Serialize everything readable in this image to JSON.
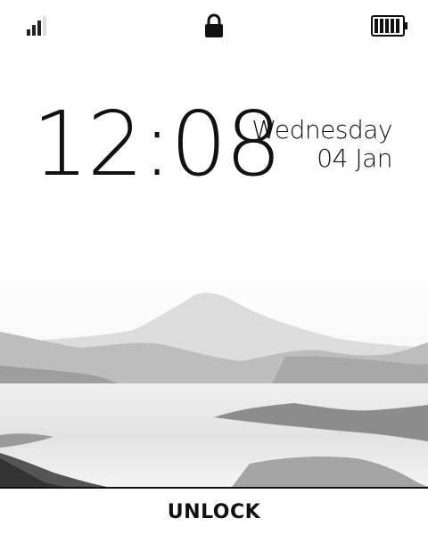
{
  "status_bar": {
    "signal_icon": "signal-icon",
    "lock_icon": "lock-icon",
    "battery_icon": "battery-icon",
    "signal_level": 0.75,
    "battery_level": 1.0
  },
  "clock": {
    "time": "12:08"
  },
  "date": {
    "weekday": "Wednesday",
    "day_month": "04 Jan"
  },
  "wallpaper": {
    "subject": "mountain landscape with fog"
  },
  "bottom": {
    "unlock_label": "UNLOCK"
  },
  "colors": {
    "foreground": "#111111",
    "background": "#ffffff"
  }
}
